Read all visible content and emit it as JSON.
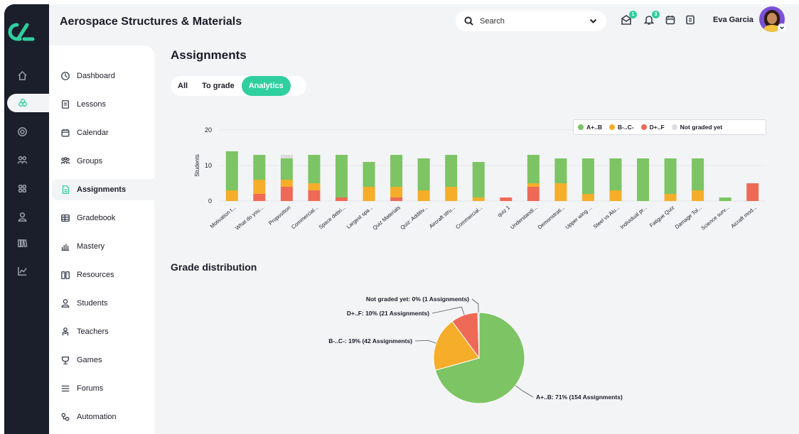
{
  "header": {
    "course_title": "Aerospace Structures & Materials",
    "search_placeholder": "Search",
    "user_name": "Eva Garcia",
    "notifications": [
      {
        "icon": "envelope-icon",
        "count": "1"
      },
      {
        "icon": "bell-icon",
        "count": "3"
      }
    ]
  },
  "rail": {
    "icons": [
      "home-icon",
      "courses-icon",
      "target-icon",
      "users-icon",
      "grid-icon",
      "person-icon",
      "library-icon",
      "chart-icon"
    ],
    "active": "courses-icon"
  },
  "nav": {
    "items": [
      {
        "label": "Dashboard",
        "icon": "dashboard-icon"
      },
      {
        "label": "Lessons",
        "icon": "lessons-icon"
      },
      {
        "label": "Calendar",
        "icon": "calendar-icon"
      },
      {
        "label": "Groups",
        "icon": "groups-icon"
      },
      {
        "label": "Assignments",
        "icon": "assignments-icon",
        "active": true
      },
      {
        "label": "Gradebook",
        "icon": "gradebook-icon"
      },
      {
        "label": "Mastery",
        "icon": "mastery-icon"
      },
      {
        "label": "Resources",
        "icon": "resources-icon"
      },
      {
        "label": "Students",
        "icon": "students-icon"
      },
      {
        "label": "Teachers",
        "icon": "teachers-icon"
      },
      {
        "label": "Games",
        "icon": "games-icon"
      },
      {
        "label": "Forums",
        "icon": "forums-icon"
      },
      {
        "label": "Automation",
        "icon": "automation-icon"
      }
    ]
  },
  "page": {
    "title": "Assignments",
    "tabs": [
      {
        "label": "All",
        "active": false
      },
      {
        "label": "To grade",
        "active": false
      },
      {
        "label": "Analytics",
        "active": true
      }
    ],
    "distribution_title": "Grade distribution"
  },
  "colors": {
    "accent": "#2fcf9f",
    "grade_a": "#7cc464",
    "grade_b": "#f5ad2a",
    "grade_d": "#ee6a57",
    "not_graded": "#dcdcdc"
  },
  "chart_data": [
    {
      "type": "bar",
      "stacked": true,
      "ylabel": "Students",
      "ylim": [
        0,
        20
      ],
      "yticks": [
        0,
        10,
        20
      ],
      "legend_position": "top-right",
      "categories": [
        "Motivation t...",
        "What do you...",
        "Proposition",
        "Commercial...",
        "Space debri...",
        "Largest spa...",
        "Quiz Materials",
        "Quiz: Additiv...",
        "Aircraft stru...",
        "Commercial...",
        "quiz 1",
        "Understandi...",
        "Demonstrati...",
        "Upper wing ...",
        "Steel vs Alu...",
        "Individual pr...",
        "Fatigue Quiz",
        "Damage Tol...",
        "Science surv...",
        "Aicraft mod..."
      ],
      "series": [
        {
          "name": "D+..F",
          "values": [
            0,
            2,
            4,
            3,
            1,
            0,
            1,
            0,
            0,
            0,
            1,
            4,
            0,
            0,
            0,
            0,
            0,
            0,
            0,
            5
          ]
        },
        {
          "name": "B-..C-",
          "values": [
            3,
            4,
            2,
            2,
            0,
            4,
            3,
            3,
            4,
            1,
            0,
            1,
            5,
            2,
            3,
            0,
            2,
            3,
            0,
            0
          ]
        },
        {
          "name": "A+..B",
          "values": [
            11,
            7,
            6,
            8,
            12,
            7,
            9,
            9,
            9,
            10,
            0,
            8,
            7,
            10,
            9,
            12,
            10,
            9,
            1,
            0
          ]
        },
        {
          "name": "Not graded yet",
          "values": [
            0,
            0,
            1,
            0,
            0,
            0,
            0,
            0,
            0,
            0,
            0,
            0,
            0,
            0,
            0,
            0,
            0,
            0,
            0,
            0
          ]
        }
      ]
    },
    {
      "type": "pie",
      "slices": [
        {
          "label": "A+..B: 71% (154 Assignments)",
          "name": "A+..B",
          "value": 154
        },
        {
          "label": "B-..C-: 19% (42 Assignments)",
          "name": "B-..C-",
          "value": 42
        },
        {
          "label": "D+..F: 10% (21 Assignments)",
          "name": "D+..F",
          "value": 21
        },
        {
          "label": "Not graded yet: 0% (1 Assignments)",
          "name": "Not graded yet",
          "value": 1
        }
      ]
    }
  ]
}
